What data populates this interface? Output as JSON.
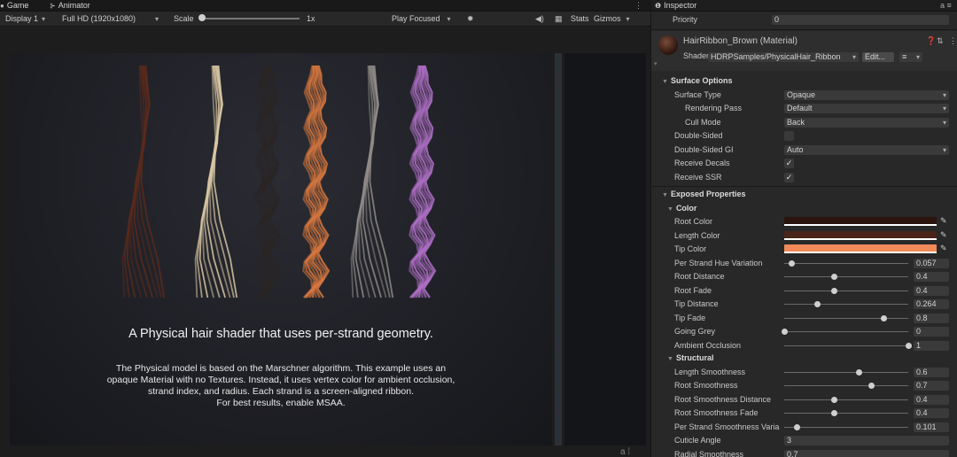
{
  "tabs": {
    "game": "Game",
    "animator": "Animator",
    "inspector": "Inspector"
  },
  "toolbar": {
    "display": "Display 1",
    "resolution": "Full HD (1920x1080)",
    "scale_label": "Scale",
    "scale_value": "1x",
    "play_mode": "Play Focused",
    "stats": "Stats",
    "gizmos": "Gizmos"
  },
  "game": {
    "caption_title": "A Physical hair shader that uses per-strand geometry.",
    "caption_lines": [
      "The Physical model is based on the Marschner algorithm. This example uses an",
      "opaque Material with no Textures. Instead, it uses vertex color for ambient occlusion,",
      "strand index, and radius. Each strand is a screen-aligned ribbon.",
      "For best results, enable MSAA."
    ],
    "hair_colors": [
      "#5a2a1c",
      "#d8c6a4",
      "#2a2524",
      "#d8783e",
      "#8f8b87",
      "#b070c8"
    ]
  },
  "inspector": {
    "priority_label": "Priority",
    "priority_value": "0",
    "material_name": "HairRibbon_Brown (Material)",
    "shader_label": "Shader",
    "shader_value": "HDRPSamples/PhysicalHair_Ribbon",
    "edit_label": "Edit...",
    "surface_options": {
      "title": "Surface Options",
      "surface_type_label": "Surface Type",
      "surface_type_value": "Opaque",
      "rendering_pass_label": "Rendering Pass",
      "rendering_pass_value": "Default",
      "cull_mode_label": "Cull Mode",
      "cull_mode_value": "Back",
      "double_sided_label": "Double-Sided",
      "double_sided_gi_label": "Double-Sided GI",
      "double_sided_gi_value": "Auto",
      "receive_decals_label": "Receive Decals",
      "receive_ssr_label": "Receive SSR"
    },
    "exposed_title": "Exposed Properties",
    "color_title": "Color",
    "colors": [
      {
        "label": "Root Color",
        "hex": "#2a140d"
      },
      {
        "label": "Length Color",
        "hex": "#4a2418"
      },
      {
        "label": "Tip Color",
        "hex": "#f08a58"
      }
    ],
    "color_sliders": [
      {
        "label": "Per Strand Hue Variation",
        "value": "0.057",
        "fraction": 0.057
      },
      {
        "label": "Root Distance",
        "value": "0.4",
        "fraction": 0.4
      },
      {
        "label": "Root Fade",
        "value": "0.4",
        "fraction": 0.4
      },
      {
        "label": "Tip Distance",
        "value": "0.264",
        "fraction": 0.264
      },
      {
        "label": "Tip Fade",
        "value": "0.8",
        "fraction": 0.8
      },
      {
        "label": "Going Grey",
        "value": "0",
        "fraction": 0.0
      },
      {
        "label": "Ambient Occlusion",
        "value": "1",
        "fraction": 1.0
      }
    ],
    "structural_title": "Structural",
    "structural_sliders": [
      {
        "label": "Length Smoothness",
        "value": "0.6",
        "fraction": 0.6
      },
      {
        "label": "Root Smoothness",
        "value": "0.7",
        "fraction": 0.7
      },
      {
        "label": "Root Smoothness Distance",
        "value": "0.4",
        "fraction": 0.4
      },
      {
        "label": "Root Smoothness Fade",
        "value": "0.4",
        "fraction": 0.4
      },
      {
        "label": "Per Strand Smoothness Varia",
        "value": "0.101",
        "fraction": 0.101
      }
    ],
    "cuticle_angle_label": "Cuticle Angle",
    "cuticle_angle_value": "3",
    "radial_smoothness_label": "Radial Smoothness",
    "radial_smoothness_value": "0.7"
  }
}
